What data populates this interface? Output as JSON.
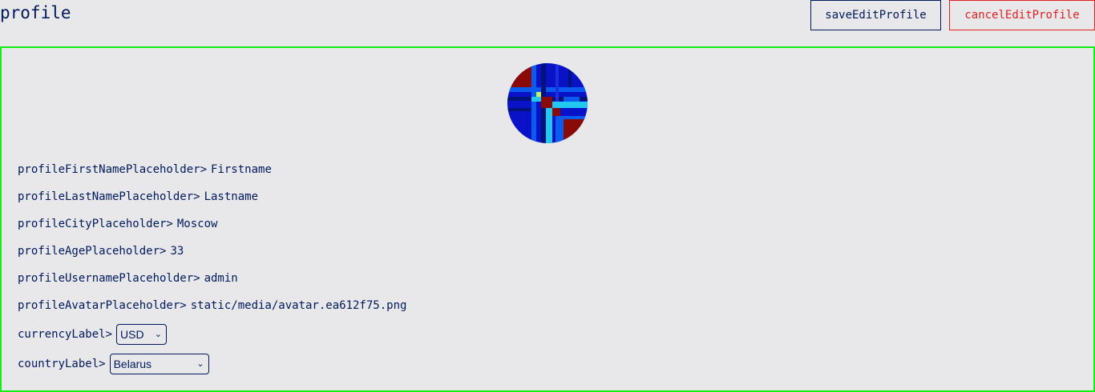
{
  "header": {
    "title": "profile",
    "save_label": "saveEditProfile",
    "cancel_label": "cancelEditProfile"
  },
  "profile": {
    "avatar_icon": "avatar-icon",
    "fields": [
      {
        "label": "profileFirstNamePlaceholder>",
        "value": "Firstname"
      },
      {
        "label": "profileLastNamePlaceholder>",
        "value": "Lastname"
      },
      {
        "label": "profileCityPlaceholder>",
        "value": "Moscow"
      },
      {
        "label": "profileAgePlaceholder>",
        "value": "33"
      },
      {
        "label": "profileUsernamePlaceholder>",
        "value": "admin"
      },
      {
        "label": "profileAvatarPlaceholder>",
        "value": "static/media/avatar.ea612f75.png"
      }
    ],
    "currency": {
      "label": "currencyLabel>",
      "value": "USD"
    },
    "country": {
      "label": "countryLabel>",
      "value": "Belarus"
    }
  },
  "colors": {
    "text": "#00195c",
    "danger": "#e02020",
    "card_border": "#11ee11",
    "background": "#e8e8eb"
  }
}
